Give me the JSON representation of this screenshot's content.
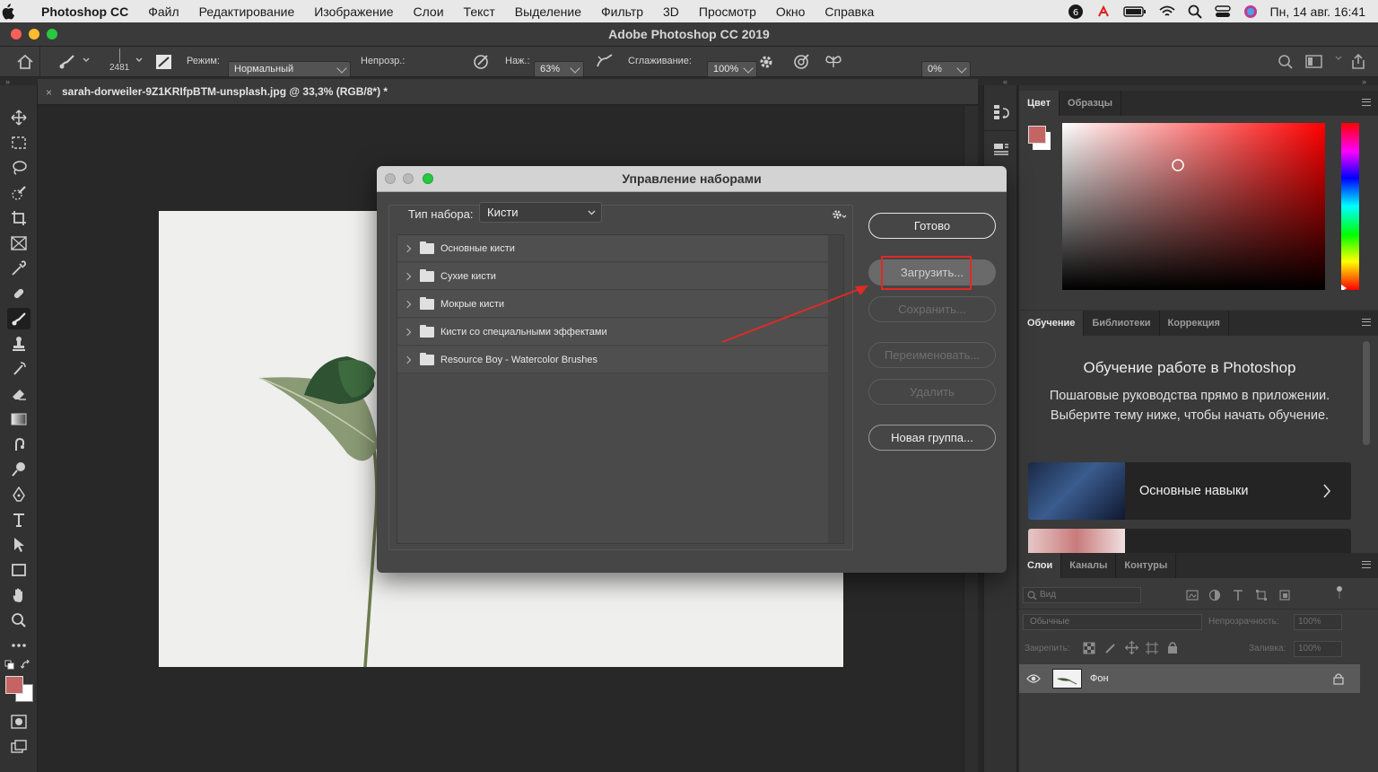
{
  "menubar": {
    "app": "Photoshop CC",
    "items": [
      "Файл",
      "Редактирование",
      "Изображение",
      "Слои",
      "Текст",
      "Выделение",
      "Фильтр",
      "3D",
      "Просмотр",
      "Окно",
      "Справка"
    ],
    "datetime": "Пн, 14 авг. 16:41"
  },
  "window": {
    "title": "Adobe Photoshop CC 2019"
  },
  "options": {
    "brush_size": "2481",
    "mode_label": "Режим:",
    "mode_value": "Нормальный",
    "opacity_label": "Непрозр.:",
    "opacity_value": "63%",
    "pressure_label": "Наж.:",
    "pressure_value": "100%",
    "smoothing_label": "Сглаживание:",
    "smoothing_value": "0%"
  },
  "document": {
    "tab_title": "sarah-dorweiler-9Z1KRIfpBTM-unsplash.jpg @ 33,3% (RGB/8*) *"
  },
  "colors": {
    "foreground": "#c46464",
    "background": "#ffffff",
    "hue": "#ff0000",
    "annotation_red": "#e02a24"
  },
  "color_panel": {
    "tabs": [
      "Цвет",
      "Образцы"
    ]
  },
  "learn_panel": {
    "tabs": [
      "Обучение",
      "Библиотеки",
      "Коррекция"
    ],
    "heading": "Обучение работе в Photoshop",
    "description": "Пошаговые руководства прямо в приложении. Выберите тему ниже, чтобы начать обучение.",
    "card_label": "Основные навыки"
  },
  "layers_panel": {
    "tabs": [
      "Слои",
      "Каналы",
      "Контуры"
    ],
    "search_placeholder": "Вид",
    "blend_mode": "Обычные",
    "opacity_label": "Непрозрачность:",
    "opacity_value": "100%",
    "lock_label": "Закрепить:",
    "fill_label": "Заливка:",
    "fill_value": "100%",
    "layers": [
      {
        "name": "Фон"
      }
    ]
  },
  "dialog": {
    "title": "Управление наборами",
    "preset_type_label": "Тип набора:",
    "preset_type_value": "Кисти",
    "presets": [
      "Основные кисти",
      "Сухие кисти",
      "Мокрые кисти",
      "Кисти со специальными эффектами",
      "Resource Boy - Watercolor Brushes"
    ],
    "buttons": {
      "done": "Готово",
      "load": "Загрузить...",
      "save": "Сохранить...",
      "rename": "Переименовать...",
      "delete": "Удалить",
      "new_group": "Новая группа..."
    }
  }
}
